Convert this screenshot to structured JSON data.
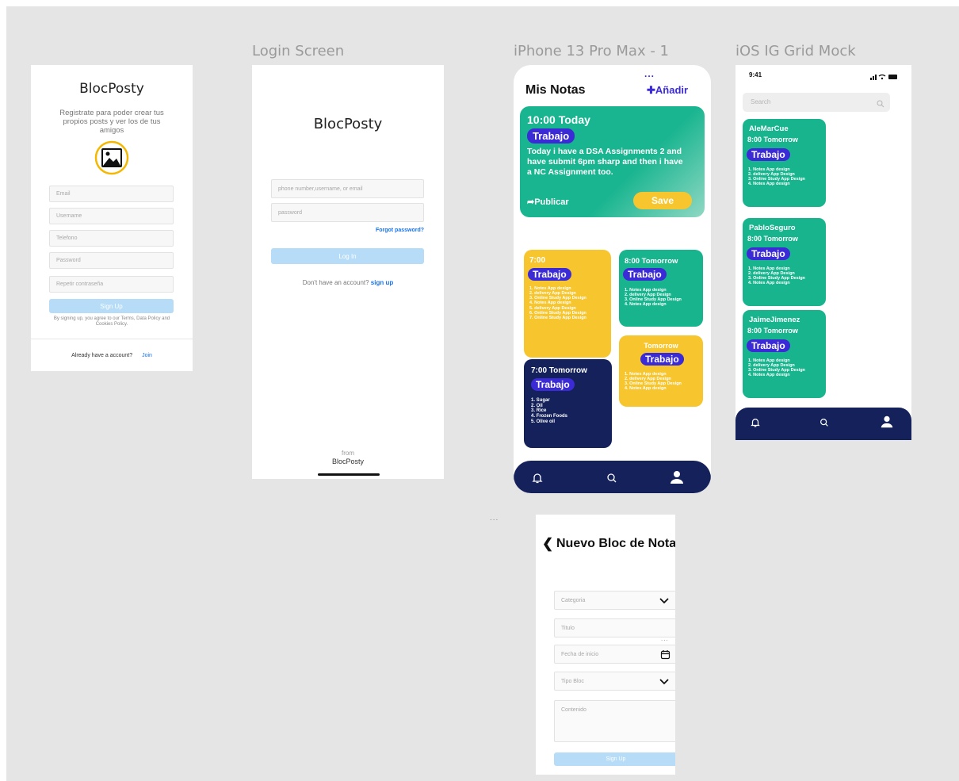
{
  "signup": {
    "brand": "BlocPosty",
    "subtitle": "Registrate para poder crear tus propios posts y ver los de tus amigos",
    "fields": [
      "Email",
      "Username",
      "Telefono",
      "Password",
      "Repetir contraseña"
    ],
    "button": "Sign Up",
    "terms": "By signing up, you agree to our Terms, Data Policy and Cookies Policy.",
    "already": "Already have a account?",
    "join": "Join"
  },
  "login": {
    "frame_title": "Login Screen",
    "brand": "BlocPosty",
    "user_placeholder": "phone number,username, or email",
    "password_placeholder": "password",
    "forgot": "Forgot password?",
    "button": "Log In",
    "no_account": "Don't have an account?",
    "signup_link": "sign up",
    "from": "from",
    "from_brand": "BlocPosty"
  },
  "notes": {
    "frame_title": "iPhone 13 Pro Max - 1",
    "dots": "...",
    "title": "Mis Notas",
    "add": "Añadir",
    "featured": {
      "time": "10:00 Today",
      "tag": "Trabajo",
      "text": "Today i have a DSA Assignments 2 and have submit 6pm sharp and then i have a NC Assignment too.",
      "publish": "Publicar",
      "save": "Save"
    },
    "card1": {
      "time": "7:00",
      "tag": "Trabajo",
      "items": [
        "1. Notes App design",
        "2. delivery App Design",
        "3. Online Study App Design",
        "4. Notes App design",
        "5. delivery App Design",
        "6. Online Study App Design",
        "7. Online Study App Design"
      ]
    },
    "card2": {
      "time": "8:00 Tomorrow",
      "tag": "Trabajo",
      "items": [
        "1. Notes App design",
        "2. delivery App Design",
        "3. Online Study App Design",
        "4. Notes App design"
      ]
    },
    "card3": {
      "time": "7:00 Tomorrow",
      "tag": "Trabajo",
      "items": [
        "1. Sugar",
        "2. Oil",
        "3. Rice",
        "4. Frozen Foods",
        "5. Olive oil"
      ]
    },
    "card4": {
      "time": "Tomorrow",
      "tag": "Trabajo",
      "items": [
        "1. Notes App design",
        "2. delivery App Design",
        "3. Online Study App Design",
        "4. Notes App design"
      ]
    },
    "nav_icons": [
      "bell-icon",
      "search-icon",
      "user-icon"
    ]
  },
  "grid": {
    "frame_title": "iOS IG Grid Mock",
    "time": "9:41",
    "search_placeholder": "Search",
    "posts": [
      {
        "user": "AleMarCue",
        "time": "8:00 Tomorrow",
        "tag": "Trabajo",
        "items": [
          "1. Notes App design",
          "2. delivery App Design",
          "3. Online Study App Design",
          "4. Notes App design"
        ]
      },
      {
        "user": "PabloSeguro",
        "time": "8:00 Tomorrow",
        "tag": "Trabajo",
        "items": [
          "1. Notes App design",
          "2. delivery App Design",
          "3. Online Study App Design",
          "4. Notes App design"
        ]
      },
      {
        "user": "JaimeJimenez",
        "time": "8:00 Tomorrow",
        "tag": "Trabajo",
        "items": [
          "1. Notes App design",
          "2. delivery App Design",
          "3. Online Study App Design",
          "4. Notes App design"
        ]
      }
    ]
  },
  "newnote": {
    "title": "Nuevo Bloc de Notas",
    "fields": {
      "categoria": "Categoria",
      "titulo": "Titulo",
      "fecha": "Fecha de inicio",
      "tipo": "Tipo Bloc",
      "contenido": "Contenido"
    },
    "button": "Sign Up"
  },
  "canvas_dots": "...",
  "colors": {
    "teal": "#18b48e",
    "yellow": "#f7c62f",
    "navy": "#14215a",
    "purple_pill": "#3b2bd6",
    "link_blue": "#1a73e8"
  }
}
